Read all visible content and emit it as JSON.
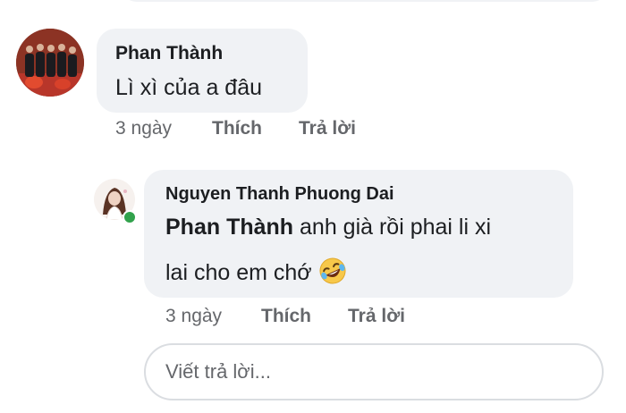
{
  "comments": [
    {
      "author": "Phan Thành",
      "text": "Lì xì của a đâu",
      "time": "3 ngày",
      "like_label": "Thích",
      "reply_label": "Trả lời"
    },
    {
      "author": "Nguyen Thanh Phuong Dai",
      "mention": "Phan Thành",
      "text_line1": "anh già rồi phai li xi",
      "text_line2": "lai cho em chớ",
      "emoji": "rofl-emoji",
      "online": true,
      "time": "3 ngày",
      "like_label": "Thích",
      "reply_label": "Trả lời"
    }
  ],
  "reply_box": {
    "placeholder": "Viết trả lời..."
  },
  "colors": {
    "bubble": "#f0f2f5",
    "meta_text": "#65676b",
    "online": "#31a24c"
  }
}
